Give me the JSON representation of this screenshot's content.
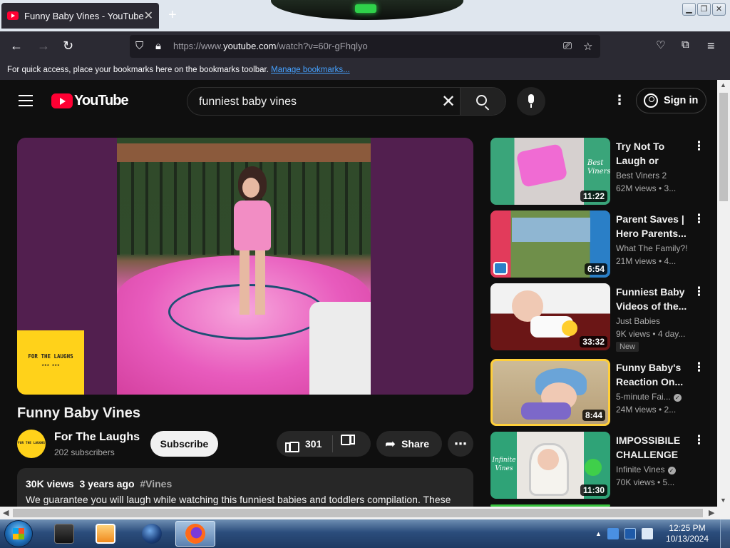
{
  "browser": {
    "tab_title": "Funny Baby Vines - YouTube",
    "url_prefix": "https://www.",
    "url_host": "youtube.com",
    "url_path": "/watch?v=60r-gFhqlyo",
    "bookmarks_text": "For quick access, place your bookmarks here on the bookmarks toolbar.",
    "bookmarks_link": "Manage bookmarks..."
  },
  "youtube": {
    "logo_text": "YouTube",
    "search_query": "funniest baby vines",
    "signin_label": "Sign in"
  },
  "video": {
    "title": "Funny Baby Vines",
    "badge_text": "FOR THE LAUGHS",
    "badge_stars": "★★★ ★★★",
    "channel_name": "For The Laughs",
    "subscribers": "202 subscribers",
    "subscribe_label": "Subscribe",
    "likes": "301",
    "share_label": "Share",
    "views": "30K views",
    "age": "3 years ago",
    "hashtag": "#Vines",
    "description": "We guarantee you will laugh while watching this funniest babies and toddlers compilation. These"
  },
  "suggestions": [
    {
      "title": "Try Not To Laugh or Grin...",
      "channel": "Best Viners 2",
      "stats": "62M views  • 3...",
      "duration": "11:22",
      "thumb_text": "Best Viners",
      "verified": false,
      "new": false
    },
    {
      "title": "Parent Saves | Hero Parents...",
      "channel": "What The Family?!",
      "stats": "21M views  • 4...",
      "duration": "6:54",
      "thumb_text": "",
      "verified": false,
      "new": false
    },
    {
      "title": "Funniest Baby Videos of the...",
      "channel": "Just Babies",
      "stats": "9K views  • 4 day...",
      "duration": "33:32",
      "thumb_text": "",
      "verified": false,
      "new": true,
      "new_label": "New"
    },
    {
      "title": "Funny Baby's Reaction On...",
      "channel": "5-minute Fai...",
      "stats": "24M views  • 2...",
      "duration": "8:44",
      "thumb_text": "",
      "verified": true,
      "new": false
    },
    {
      "title": "IMPOSSIBILE CHALLENGE :...",
      "channel": "Infinite Vines",
      "stats": "70K views  • 5...",
      "duration": "11:30",
      "thumb_text": "Infinite Vines",
      "verified": true,
      "new": false
    }
  ],
  "taskbar": {
    "time": "12:25 PM",
    "date": "10/13/2024"
  },
  "colors": {
    "yt_red": "#ff0033",
    "background": "#0f0f0f",
    "player_purple": "#521f4f",
    "badge_yellow": "#ffd21a"
  }
}
